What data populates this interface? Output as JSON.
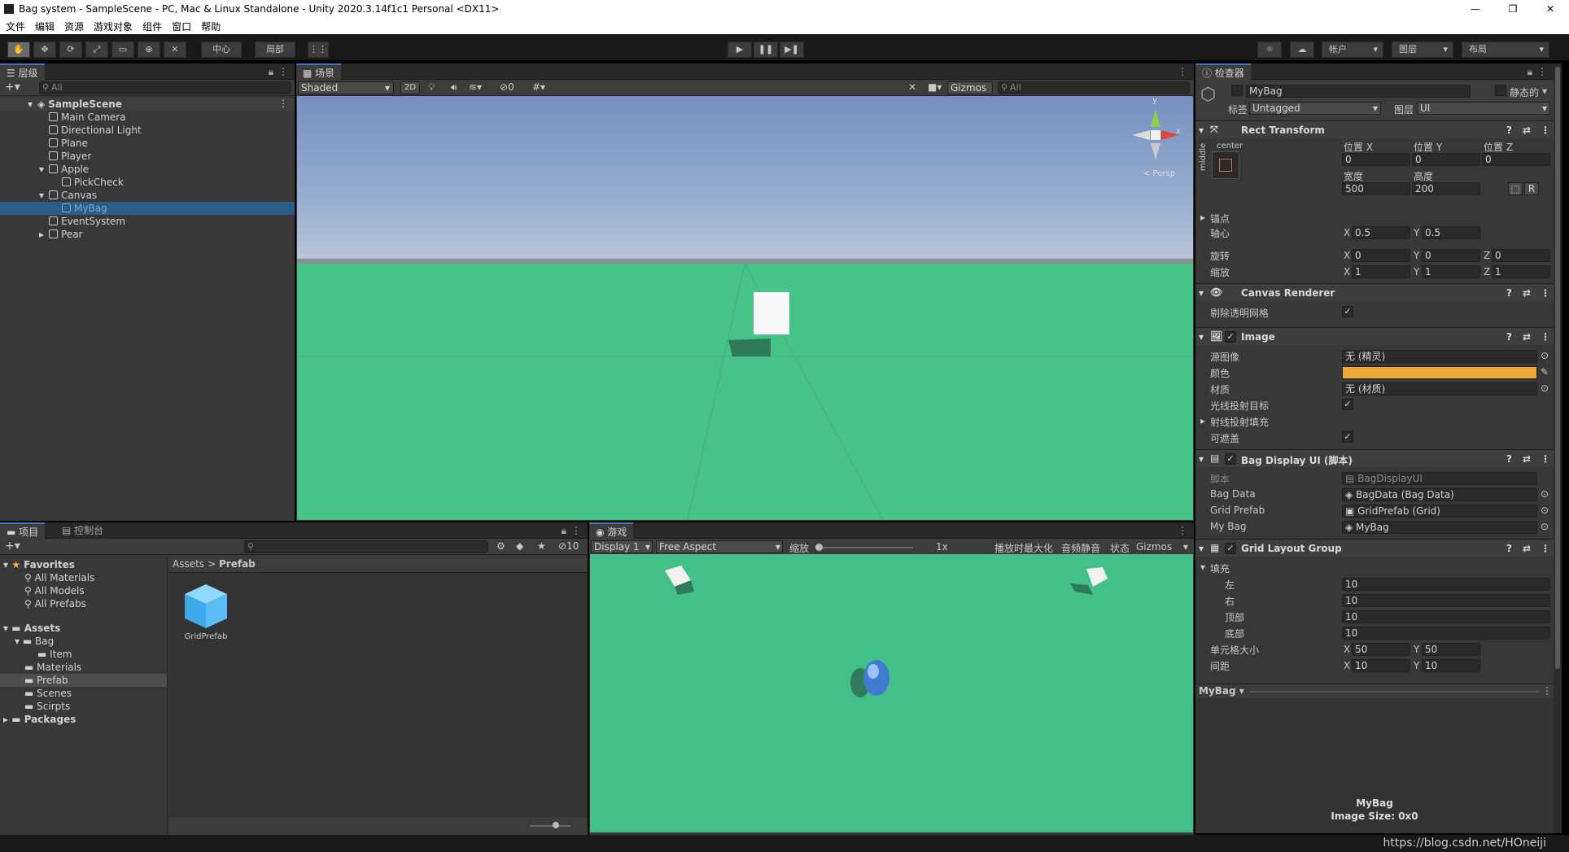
{
  "window": {
    "title": "Bag system - SampleScene - PC, Mac & Linux Standalone - Unity 2020.3.14f1c1 Personal <DX11>",
    "minimize": "—",
    "restore": "❐",
    "close": "✕"
  },
  "menu": [
    "文件",
    "编辑",
    "资源",
    "游戏对象",
    "组件",
    "窗口",
    "帮助"
  ],
  "toolbar": {
    "pivot_center": "中心",
    "pivot_local": "局部",
    "play": "▶",
    "pause": "❚❚",
    "step": "▶❚",
    "account": "帐户",
    "layers": "图层",
    "layout": "布局"
  },
  "hierarchy": {
    "tab": "层级",
    "search_placeholder": "All",
    "items": [
      {
        "label": "SampleScene",
        "depth": 0
      },
      {
        "label": "Main Camera",
        "depth": 1
      },
      {
        "label": "Directional Light",
        "depth": 1
      },
      {
        "label": "Plane",
        "depth": 1
      },
      {
        "label": "Player",
        "depth": 1
      },
      {
        "label": "Apple",
        "depth": 1
      },
      {
        "label": "PickCheck",
        "depth": 2
      },
      {
        "label": "Canvas",
        "depth": 1
      },
      {
        "label": "MyBag",
        "depth": 2
      },
      {
        "label": "EventSystem",
        "depth": 1
      },
      {
        "label": "Pear",
        "depth": 1
      }
    ]
  },
  "scene": {
    "tab": "场景",
    "shading": "Shaded",
    "mode_2d": "2D",
    "hidden_count": "0",
    "gizmos": "Gizmos",
    "search_placeholder": "All",
    "persp": "< Persp",
    "axis_y": "y",
    "axis_x": "x"
  },
  "project": {
    "tab_project": "项目",
    "tab_console": "控制台",
    "hidden_count": "10",
    "favorites_title": "Favorites",
    "favorites": [
      "All Materials",
      "All Models",
      "All Prefabs"
    ],
    "assets_title": "Assets",
    "assets": [
      {
        "label": "Bag",
        "depth": 1
      },
      {
        "label": "Item",
        "depth": 2
      },
      {
        "label": "Materials",
        "depth": 1
      },
      {
        "label": "Prefab",
        "depth": 1
      },
      {
        "label": "Scenes",
        "depth": 1
      },
      {
        "label": "Scirpts",
        "depth": 1
      }
    ],
    "packages": "Packages",
    "breadcrumb_root": "Assets",
    "breadcrumb_sep": ">",
    "breadcrumb_current": "Prefab",
    "asset_item": "GridPrefab"
  },
  "game": {
    "tab": "游戏",
    "display": "Display 1",
    "aspect": "Free Aspect",
    "scale_label": "缩放",
    "scale_value": "1x",
    "maximize": "播放时最大化",
    "mute": "音频静音",
    "stats": "状态",
    "gizmos": "Gizmos"
  },
  "inspector": {
    "tab": "检查器",
    "object_name": "MyBag",
    "static_label": "静态的",
    "tag_label": "标签",
    "tag_value": "Untagged",
    "layer_label": "图层",
    "layer_value": "UI",
    "rect_transform": {
      "title": "Rect Transform",
      "anchor_h": "center",
      "anchor_v": "middle",
      "pos_x_label": "位置 X",
      "pos_y_label": "位置 Y",
      "pos_z_label": "位置 Z",
      "pos_x": "0",
      "pos_y": "0",
      "pos_z": "0",
      "width_label": "宽度",
      "height_label": "高度",
      "width": "500",
      "height": "200",
      "r_btn": "R",
      "anchors_label": "锚点",
      "pivot_label": "轴心",
      "pivot_x": "0.5",
      "pivot_y": "0.5",
      "rotation_label": "旋转",
      "rot_x": "0",
      "rot_y": "0",
      "rot_z": "0",
      "scale_label": "缩放",
      "scale_x": "1",
      "scale_y": "1",
      "scale_z": "1"
    },
    "canvas_renderer": {
      "title": "Canvas Renderer",
      "cull_label": "剔除透明网格"
    },
    "image": {
      "title": "Image",
      "source_label": "源图像",
      "source_value": "无 (精灵)",
      "color_label": "颜色",
      "color": "#f0a838",
      "material_label": "材质",
      "material_value": "无 (材质)",
      "raycast_target": "光线投射目标",
      "raycast_padding": "射线投射填充",
      "maskable": "可遮盖"
    },
    "bag_display": {
      "title": "Bag Display UI   (脚本)",
      "script_label": "脚本",
      "script_value": "BagDisplayUI",
      "bag_data_label": "Bag Data",
      "bag_data_value": "BagData (Bag Data)",
      "grid_prefab_label": "Grid Prefab",
      "grid_prefab_value": "GridPrefab (Grid)",
      "my_bag_label": "My Bag",
      "my_bag_value": "MyBag"
    },
    "grid_layout": {
      "title": "Grid Layout Group",
      "padding_label": "填充",
      "left_label": "左",
      "left": "10",
      "right_label": "右",
      "right": "10",
      "top_label": "顶部",
      "top": "10",
      "bottom_label": "底部",
      "bottom": "10",
      "cell_label": "单元格大小",
      "cell_x": "50",
      "cell_y": "50",
      "spacing_label": "间距",
      "spacing_x": "10",
      "spacing_y": "10"
    },
    "preview_dropdown": "MyBag",
    "preview_name": "MyBag",
    "preview_size": "Image Size: 0x0"
  },
  "watermark": "https://blog.csdn.net/HOneiji",
  "axis_labels": {
    "x": "X",
    "y": "Y",
    "z": "Z"
  }
}
